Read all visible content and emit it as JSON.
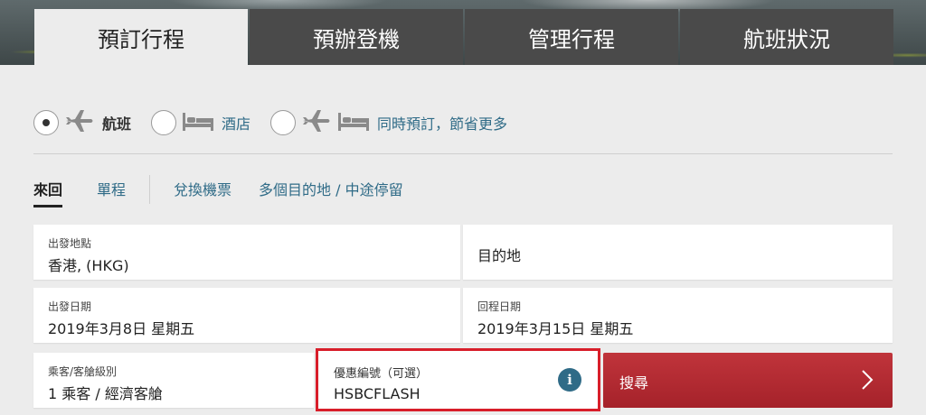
{
  "nav_tabs": [
    {
      "label": "預訂行程",
      "active": true
    },
    {
      "label": "預辦登機",
      "active": false
    },
    {
      "label": "管理行程",
      "active": false
    },
    {
      "label": "航班狀況",
      "active": false
    }
  ],
  "product_options": [
    {
      "label": "航班",
      "selected": true,
      "icons": [
        "plane-icon"
      ]
    },
    {
      "label": "酒店",
      "selected": false,
      "icons": [
        "bed-icon"
      ]
    },
    {
      "label": "同時預訂，節省更多",
      "selected": false,
      "icons": [
        "plane-icon",
        "bed-icon"
      ]
    }
  ],
  "trip_types": {
    "round_trip": "來回",
    "one_way": "單程",
    "redeem": "兌換機票",
    "multi_city": "多個目的地 / 中途停留"
  },
  "form": {
    "origin": {
      "label": "出發地點",
      "value": "香港, (HKG)"
    },
    "destination": {
      "placeholder": "目的地"
    },
    "depart_date": {
      "label": "出發日期",
      "value": "2019年3月8日 星期五"
    },
    "return_date": {
      "label": "回程日期",
      "value": "2019年3月15日 星期五"
    },
    "passengers": {
      "label": "乘客/客艙級別",
      "value": "1 乘客 / 經濟客艙"
    },
    "promo": {
      "label": "優惠編號（可選）",
      "value": "HSBCFLASH"
    },
    "info_glyph": "i",
    "search_label": "搜尋"
  },
  "colors": {
    "accent_link": "#2f6b87",
    "search_button": "#b52a31",
    "highlight_border": "#d81e2a",
    "tab_dark": "#4a4a4a"
  }
}
